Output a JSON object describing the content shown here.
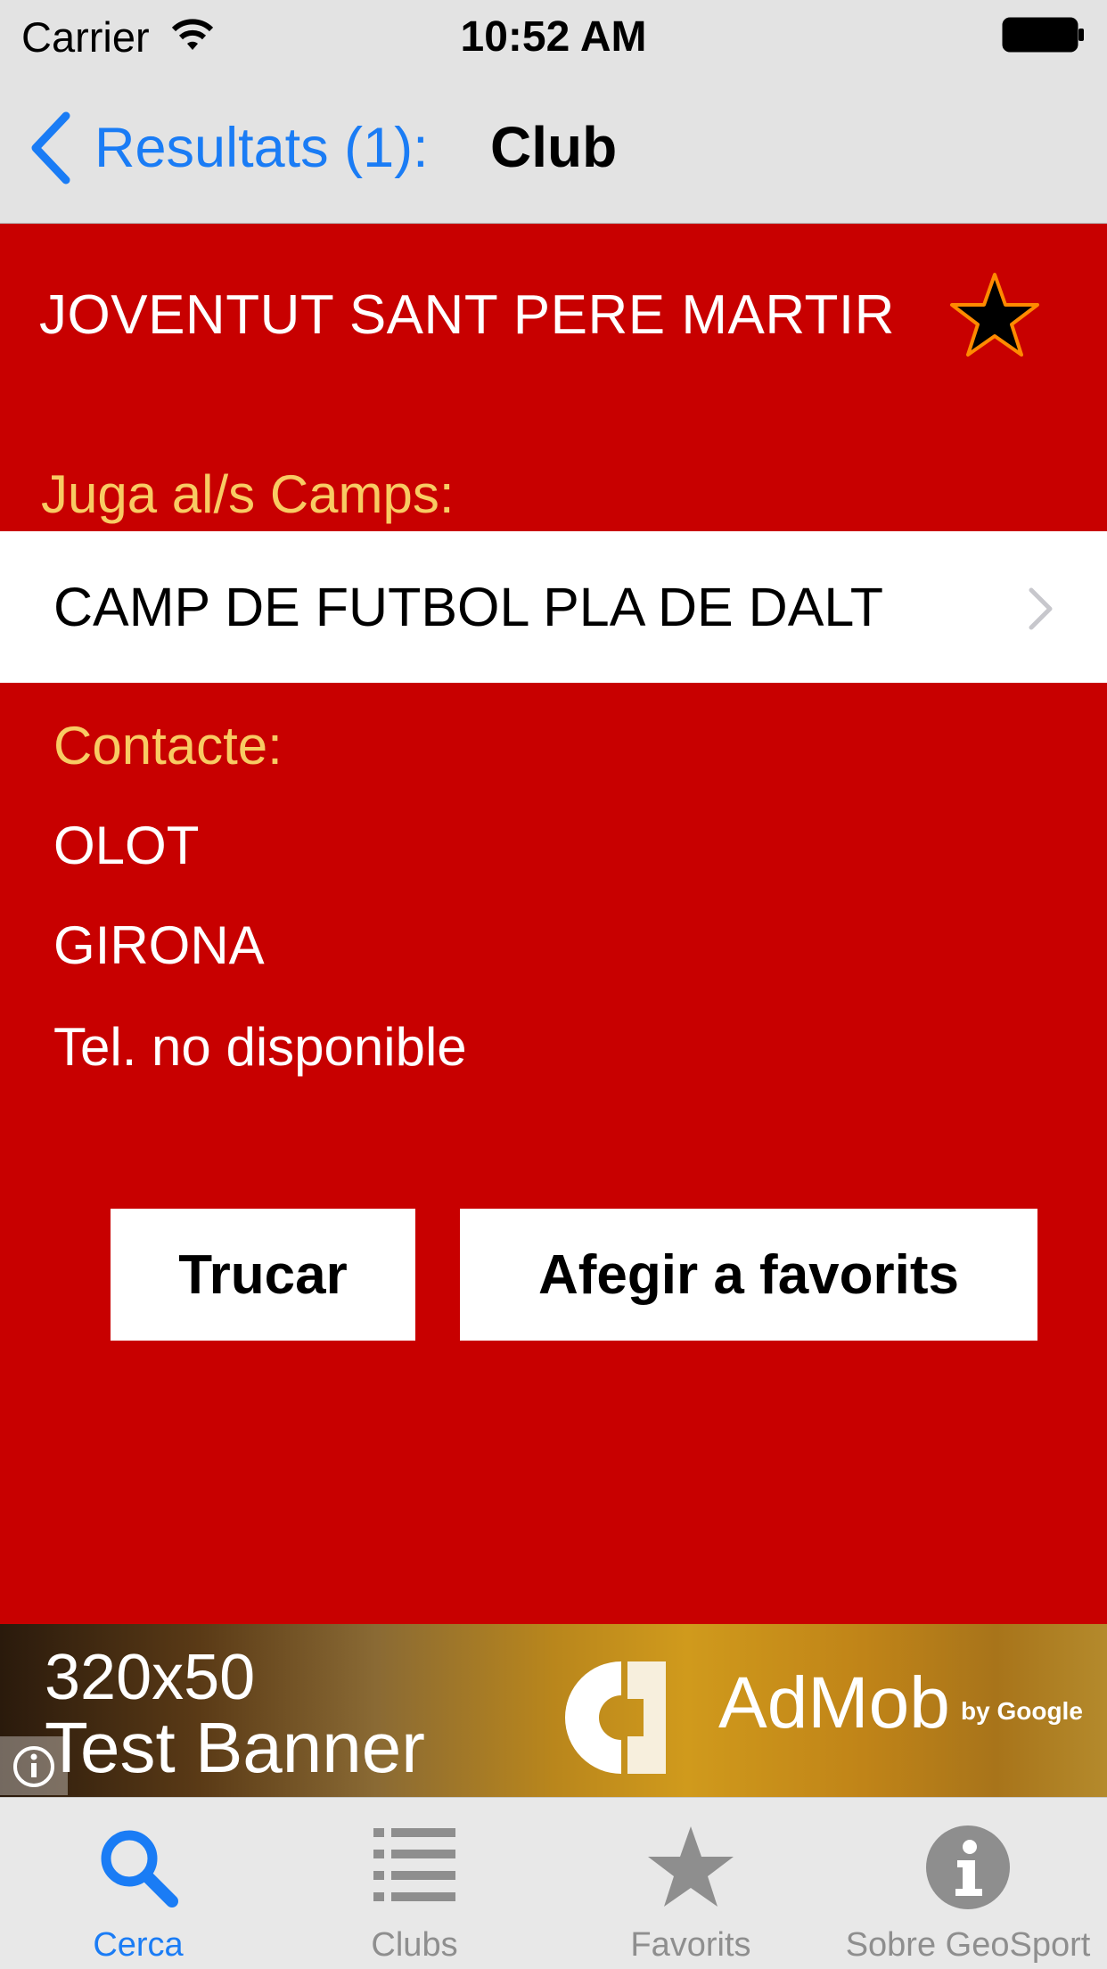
{
  "status_bar": {
    "carrier": "Carrier",
    "time": "10:52 AM"
  },
  "nav": {
    "back_label": "Resultats (1):",
    "title": "Club"
  },
  "club": {
    "name": "JOVENTUT SANT PERE MARTIR",
    "fields_label": "Juga al/s Camps:",
    "fields": [
      "CAMP DE FUTBOL PLA DE DALT"
    ],
    "contact_label": "Contacte:",
    "contact": {
      "city": "OLOT",
      "province": "GIRONA",
      "phone": "Tel. no disponible"
    }
  },
  "actions": {
    "call": "Trucar",
    "add_favorite": "Afegir a favorits"
  },
  "ad": {
    "size": "320x50",
    "label": "Test Banner",
    "brand": "AdMob",
    "by": "by Google"
  },
  "tabs": [
    {
      "label": "Cerca",
      "icon": "search-icon",
      "active": true
    },
    {
      "label": "Clubs",
      "icon": "list-icon",
      "active": false
    },
    {
      "label": "Favorits",
      "icon": "star-icon",
      "active": false
    },
    {
      "label": "Sobre GeoSport",
      "icon": "info-icon",
      "active": false
    }
  ],
  "colors": {
    "background": "#c80000",
    "section_label": "#f8cb63",
    "accent": "#1a7cf5",
    "inactive_tab": "#8e8e8e"
  }
}
